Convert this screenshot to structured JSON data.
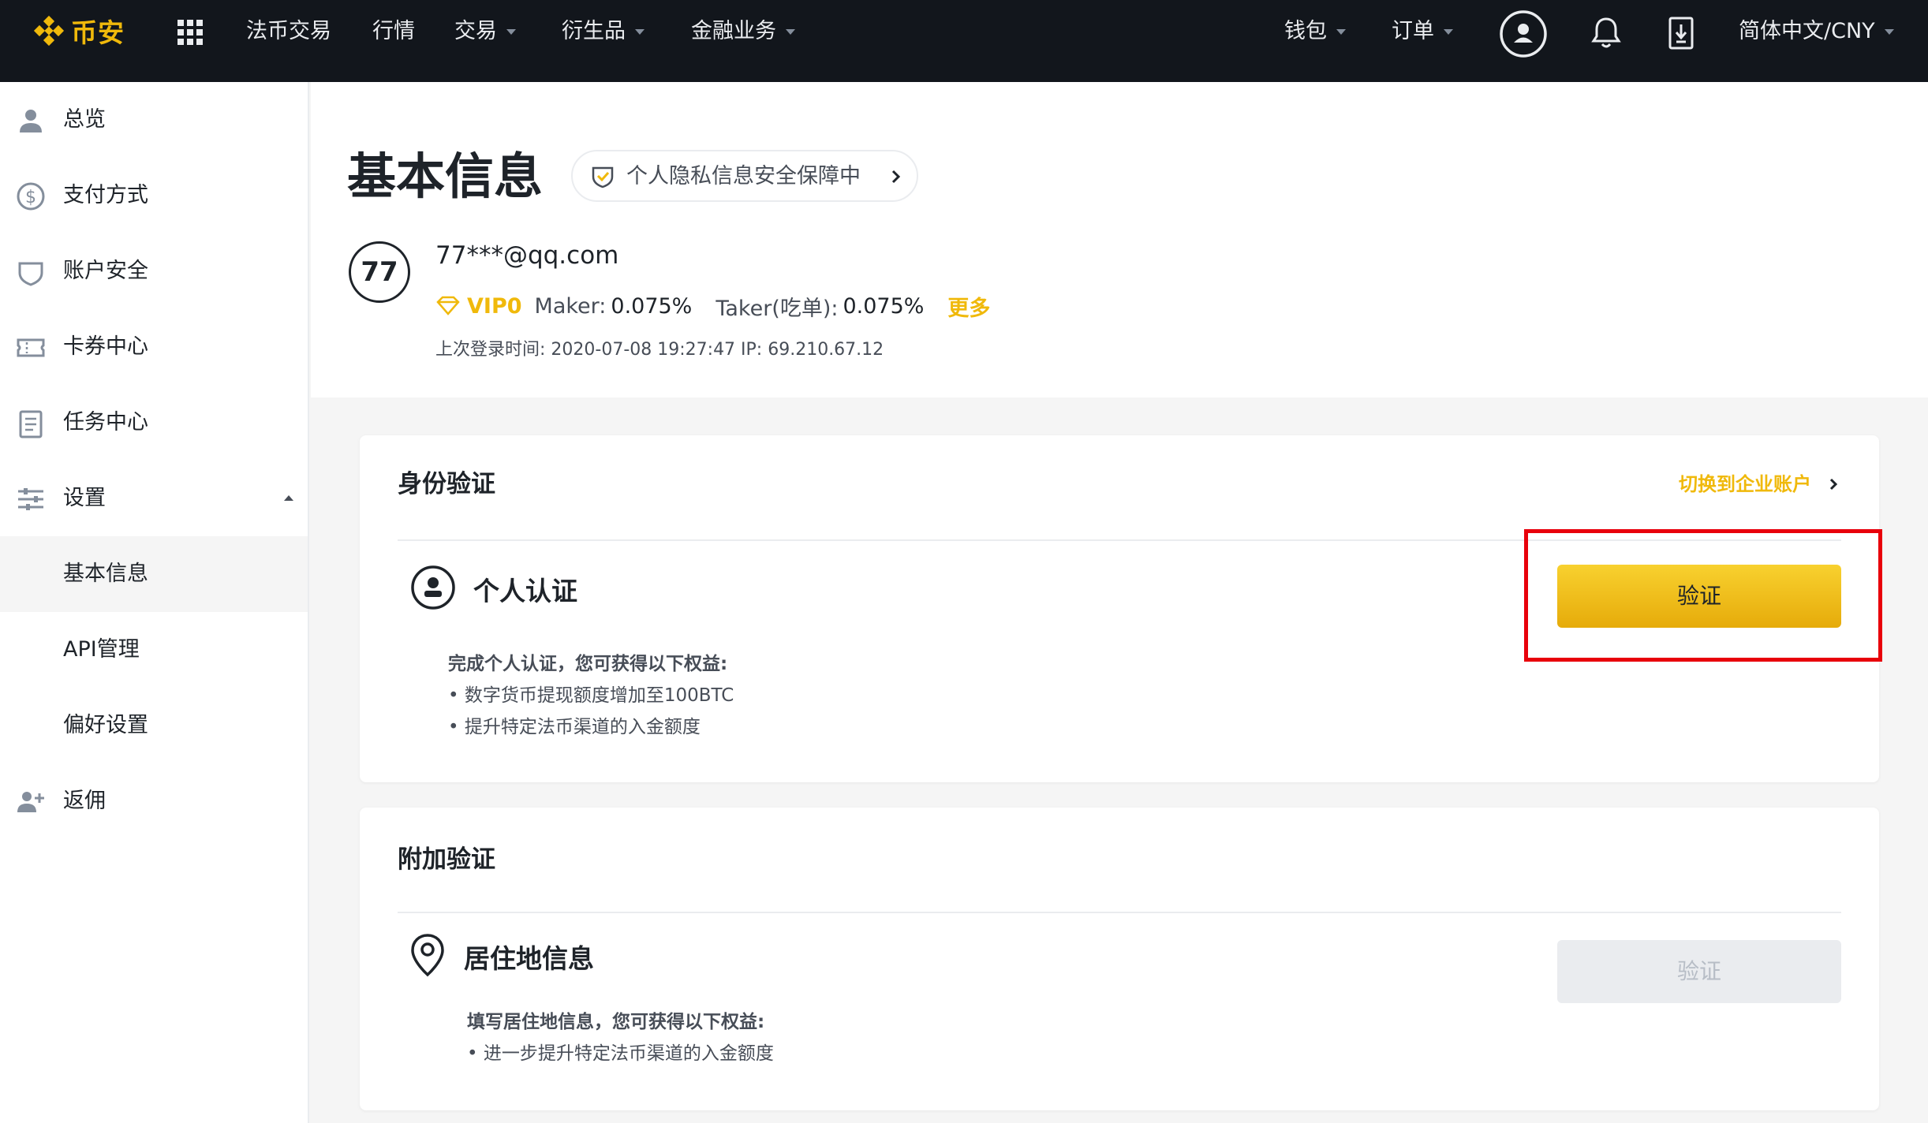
{
  "topbar": {
    "brand": "币安",
    "nav": [
      {
        "label": "法币交易",
        "dropdown": false
      },
      {
        "label": "行情",
        "dropdown": false
      },
      {
        "label": "交易",
        "dropdown": true
      },
      {
        "label": "衍生品",
        "dropdown": true
      },
      {
        "label": "金融业务",
        "dropdown": true
      }
    ],
    "wallet": "钱包",
    "orders": "订单",
    "locale": "简体中文/CNY",
    "icons": [
      "grid-icon",
      "user-circle-icon",
      "bell-icon",
      "download-icon"
    ]
  },
  "sidebar": {
    "items": [
      {
        "label": "总览",
        "icon": "user-icon"
      },
      {
        "label": "支付方式",
        "icon": "dollar-icon"
      },
      {
        "label": "账户安全",
        "icon": "shield-icon"
      },
      {
        "label": "卡券中心",
        "icon": "ticket-icon"
      },
      {
        "label": "任务中心",
        "icon": "clipboard-icon"
      },
      {
        "label": "设置",
        "icon": "sliders-icon",
        "expanded": true
      },
      {
        "label": "基本信息",
        "active": true
      },
      {
        "label": "API管理"
      },
      {
        "label": "偏好设置"
      },
      {
        "label": "返佣",
        "icon": "add-user-icon"
      }
    ]
  },
  "profile": {
    "page_title": "基本信息",
    "privacy_label": "个人隐私信息安全保障中",
    "avatar_text": "77",
    "email": "77***@qq.com",
    "vip": "VIP0",
    "maker_label": "Maker:",
    "maker_value": "0.075%",
    "taker_label": "Taker(吃单):",
    "taker_value": "0.075%",
    "more": "更多",
    "last_login": "上次登录时间: 2020-07-08 19:27:47   IP: 69.210.67.12"
  },
  "identity_card": {
    "title": "身份验证",
    "switch_link": "切换到企业账户",
    "section_label": "个人认证",
    "benefit_title": "完成个人认证，您可获得以下权益:",
    "benefits": [
      "• 数字货币提现额度增加至100BTC",
      "• 提升特定法币渠道的入金额度"
    ],
    "button": "验证"
  },
  "extra_card": {
    "title": "附加验证",
    "section_label": "居住地信息",
    "benefit_title": "填写居住地信息，您可获得以下权益:",
    "benefits": [
      "• 进一步提升特定法币渠道的入金额度"
    ],
    "button": "验证"
  },
  "colors": {
    "brand_yellow": "#F0B90B",
    "topbar_bg": "#12161C",
    "highlight_red": "#E8000B"
  }
}
